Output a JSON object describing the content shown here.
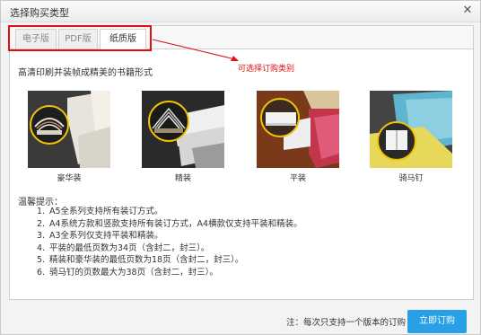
{
  "window": {
    "title": "选择购买类型",
    "close_glyph": "✕"
  },
  "tabs": [
    {
      "label": "电子版",
      "active": false
    },
    {
      "label": "PDF版",
      "active": false
    },
    {
      "label": "纸质版",
      "active": true
    }
  ],
  "annotation": {
    "text": "可选择订购类别",
    "color": "#e01010"
  },
  "description": "高清印刷并装帧成精美的书籍形式",
  "bindings": [
    {
      "label": "豪华装",
      "icon": "luxury-binding-photo"
    },
    {
      "label": "精装",
      "icon": "hardcover-binding-photo"
    },
    {
      "label": "平装",
      "icon": "paperback-binding-photo"
    },
    {
      "label": "骑马钉",
      "icon": "saddle-stitch-binding-photo"
    }
  ],
  "tips": {
    "title": "温馨提示：",
    "items": [
      {
        "num": "1.",
        "text": "A5全系列支持所有装订方式。"
      },
      {
        "num": "2.",
        "text": "A4系统方款和竖款支持所有装订方式，A4横款仅支持平装和精装。"
      },
      {
        "num": "3.",
        "text": "A3全系列仅支持平装和精装。"
      },
      {
        "num": "4.",
        "text": "平装的最低页数为34页（含封二，封三）。"
      },
      {
        "num": "5.",
        "text": "精装和豪华装的最低页数为18页（含封二，封三）。"
      },
      {
        "num": "6.",
        "text": "骑马钉的页数最大为38页（含封二，封三）。"
      }
    ]
  },
  "footer": {
    "note": "注：每次只支持一个版本的订购",
    "order_button": "立即订购"
  },
  "colors": {
    "accent": "#27a0e6",
    "highlight": "#e01010"
  }
}
